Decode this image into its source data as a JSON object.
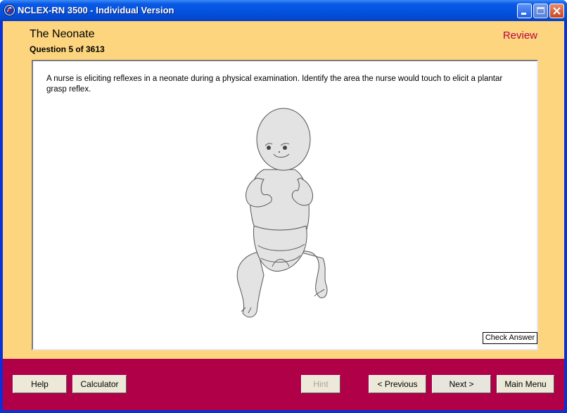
{
  "window": {
    "title": "NCLEX-RN 3500 - Individual Version",
    "icons": {
      "app": "app-logo-icon",
      "minimize": "minimize-icon",
      "maximize": "maximize-icon",
      "close": "close-icon"
    }
  },
  "header": {
    "topic": "The Neonate",
    "question_counter": "Question 5 of 3613",
    "mode": "Review"
  },
  "question": {
    "text": "A nurse is eliciting reflexes in a neonate during a physical examination. Identify the area the nurse would touch to elicit a plantar grasp reflex.",
    "image": "neonate-illustration",
    "check_answer_label": "Check Answer"
  },
  "footer": {
    "help_label": "Help",
    "calculator_label": "Calculator",
    "hint_label": "Hint",
    "previous_label": "< Previous",
    "next_label": "Next >",
    "main_menu_label": "Main Menu"
  },
  "colors": {
    "titlebar": "#0453de",
    "background": "#fdd57f",
    "footer": "#af0048",
    "review_text": "#b8003d",
    "button_face": "#ece9d8"
  }
}
